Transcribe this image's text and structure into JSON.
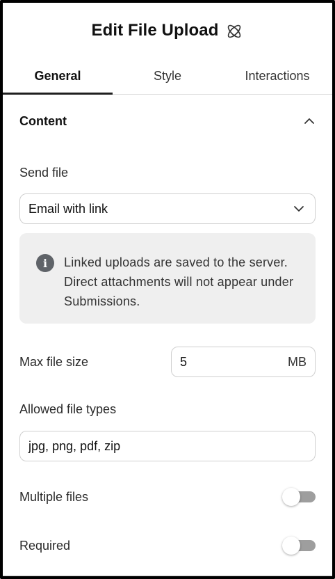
{
  "header": {
    "title": "Edit File Upload",
    "icon": "atom-icon"
  },
  "tabs": [
    {
      "label": "General",
      "active": true
    },
    {
      "label": "Style",
      "active": false
    },
    {
      "label": "Interactions",
      "active": false
    }
  ],
  "section": {
    "label": "Content",
    "expanded": true
  },
  "send_file": {
    "label": "Send file",
    "value": "Email with link"
  },
  "note": {
    "text": "Linked uploads are saved to the server. Direct attachments will not appear under Submissions."
  },
  "max_file_size": {
    "label": "Max file size",
    "value": "5",
    "unit": "MB"
  },
  "allowed_types": {
    "label": "Allowed file types",
    "value": "jpg, png, pdf, zip"
  },
  "multiple_files": {
    "label": "Multiple files",
    "on": false
  },
  "required": {
    "label": "Required",
    "on": false
  },
  "colors": {
    "accent": "#1f1f1f",
    "note_bg": "#efefef",
    "toggle_track": "#9e9e9e"
  }
}
